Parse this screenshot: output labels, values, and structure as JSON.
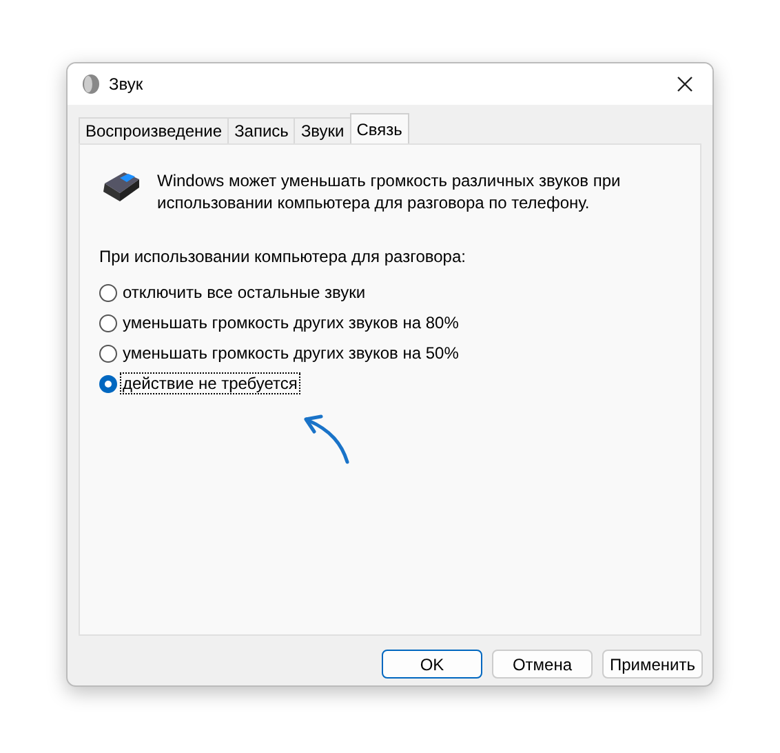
{
  "window": {
    "title": "Звук"
  },
  "tabs": [
    {
      "label": "Воспроизведение",
      "selected": false
    },
    {
      "label": "Запись",
      "selected": false
    },
    {
      "label": "Звуки",
      "selected": false
    },
    {
      "label": "Связь",
      "selected": true
    }
  ],
  "description": "Windows может уменьшать громкость различных звуков при использовании компьютера для разговора по телефону.",
  "group_label": "При использовании компьютера для разговора:",
  "options": [
    {
      "label": "отключить все остальные звуки",
      "selected": false
    },
    {
      "label": "уменьшать громкость других звуков на 80%",
      "selected": false
    },
    {
      "label": "уменьшать громкость других звуков на 50%",
      "selected": false
    },
    {
      "label": "действие не требуется",
      "selected": true
    }
  ],
  "buttons": [
    {
      "label": "OK",
      "kind": "default"
    },
    {
      "label": "Отмена",
      "kind": "normal"
    },
    {
      "label": "Применить",
      "kind": "normal"
    }
  ]
}
